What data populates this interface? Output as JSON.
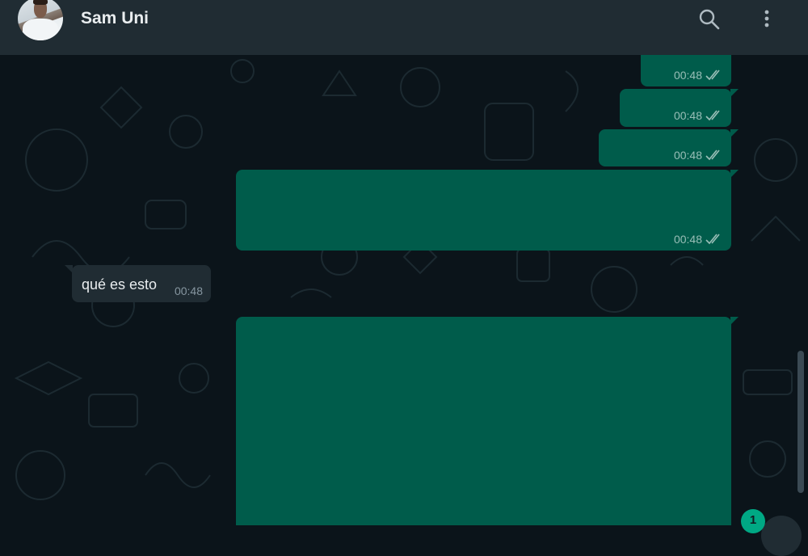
{
  "header": {
    "contact_name": "Sam Uni",
    "icons": [
      "avatar",
      "search-icon",
      "menu-dots-icon"
    ]
  },
  "messages": [
    {
      "direction": "out",
      "text": "",
      "time": "00:48",
      "status": "read-double-check"
    },
    {
      "direction": "out",
      "text": "",
      "time": "00:48",
      "status": "read-double-check"
    },
    {
      "direction": "out",
      "text": "",
      "time": "00:48",
      "status": "read-double-check"
    },
    {
      "direction": "out",
      "text": "",
      "time": "00:48",
      "status": "read-double-check"
    },
    {
      "direction": "in",
      "text": "qué es esto",
      "time": "00:48"
    },
    {
      "direction": "out",
      "text": "",
      "time": "",
      "status": ""
    }
  ],
  "unread_badge": "1",
  "colors": {
    "header_bg": "#202c33",
    "chat_bg": "#0b141a",
    "outgoing_bubble": "#005c4b",
    "incoming_bubble": "#202c33",
    "accent": "#00a884"
  }
}
